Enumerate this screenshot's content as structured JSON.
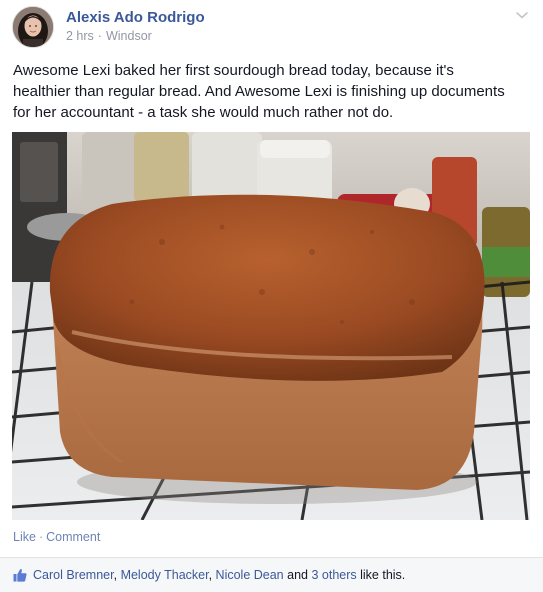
{
  "post": {
    "author": "Alexis Ado Rodrigo",
    "time": "2 hrs",
    "separator": "·",
    "location": "Windsor",
    "text": "Awesome Lexi baked her first sourdough bread today, because it's\nhealthier than regular bread. And Awesome Lexi is finishing up documents\nfor her accountant - a task she would much rather not do.",
    "menu_icon": "chevron-down-icon"
  },
  "actions": {
    "like_label": "Like",
    "separator": "·",
    "comment_label": "Comment"
  },
  "likes": {
    "icon": "thumbs-up-icon",
    "names": [
      "Carol Bremner",
      "Melody Thacker",
      "Nicole Dean"
    ],
    "comma": ",",
    "and": "and",
    "others": "3 others",
    "suffix": "like this."
  },
  "colors": {
    "link": "#3b5998",
    "action_link": "#6d84b4",
    "meta": "#9197a3",
    "footer_bg": "#f6f7f9"
  }
}
